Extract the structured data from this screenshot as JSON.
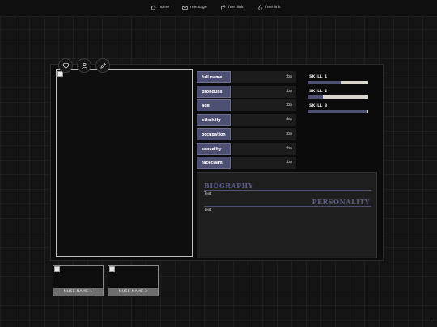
{
  "nav": {
    "items": [
      {
        "label": "home",
        "icon": "home-icon"
      },
      {
        "label": "message",
        "icon": "mail-icon"
      },
      {
        "label": "free link",
        "icon": "link-icon"
      },
      {
        "label": "free link",
        "icon": "drop-icon"
      }
    ]
  },
  "actions": [
    {
      "icon": "heart-icon"
    },
    {
      "icon": "user-icon"
    },
    {
      "icon": "pencil-icon"
    }
  ],
  "info": [
    {
      "label": "full name",
      "value": "tba"
    },
    {
      "label": "pronouns",
      "value": "tba"
    },
    {
      "label": "age",
      "value": "tba"
    },
    {
      "label": "ethnicity",
      "value": "tba"
    },
    {
      "label": "occupation",
      "value": "tba"
    },
    {
      "label": "sexuality",
      "value": "tba"
    },
    {
      "label": "faceclaim",
      "value": "tba"
    }
  ],
  "skills": [
    {
      "label": "SKILL 1",
      "level": 0.55
    },
    {
      "label": "SKILL 2",
      "level": 0.25
    },
    {
      "label": "SKILL 3",
      "level": 0.97
    }
  ],
  "bio": {
    "biography_title": "BIOGRAPHY",
    "biography_text": "Text",
    "personality_title": "PERSONALITY",
    "personality_text": "Text"
  },
  "muses": [
    {
      "label": "MUSE NAME 1"
    },
    {
      "label": "MUSE NAME 2"
    }
  ],
  "corner_mark": "L",
  "colors": {
    "accent": "#4d4f73",
    "heading": "#5b5e86",
    "bar_track": "#d9d4cc"
  }
}
